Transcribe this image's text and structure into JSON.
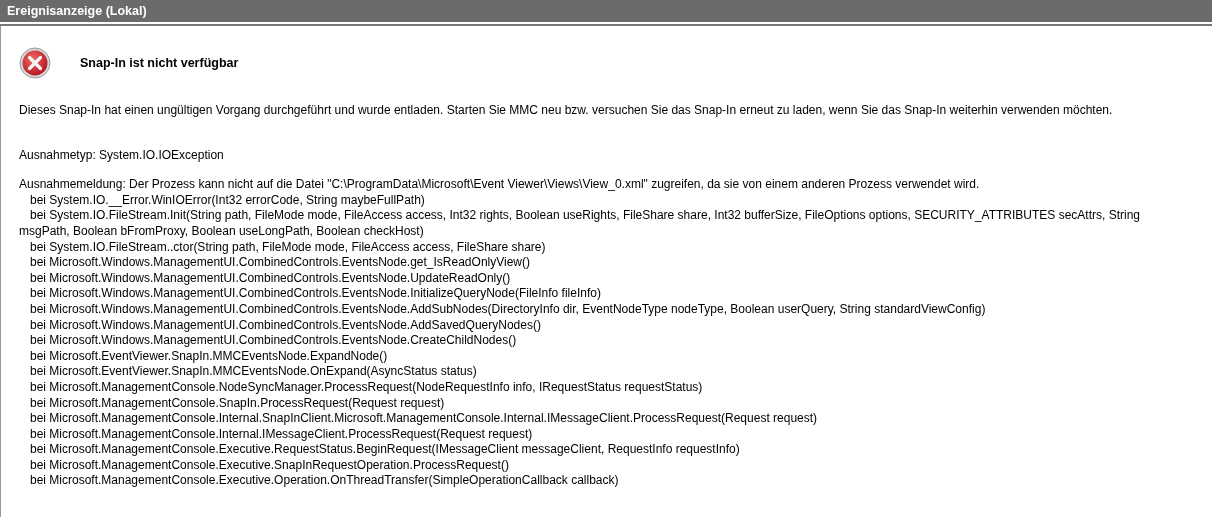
{
  "window": {
    "title": "Ereignisanzeige (Lokal)"
  },
  "error": {
    "heading": "Snap-In ist nicht verfügbar",
    "description": "Dieses Snap-In hat einen ungültigen Vorgang durchgeführt und wurde entladen. Starten Sie MMC neu bzw. versuchen Sie das Snap-In erneut zu laden, wenn Sie das Snap-In weiterhin verwenden möchten.",
    "exception_type": "Ausnahmetyp: System.IO.IOException",
    "exception_message": "Ausnahmemeldung: Der Prozess kann nicht auf die Datei \"C:\\ProgramData\\Microsoft\\Event Viewer\\Views\\View_0.xml\" zugreifen, da sie von einem anderen Prozess verwendet wird.",
    "stack_trace": [
      "bei System.IO.__Error.WinIOError(Int32 errorCode, String maybeFullPath)",
      "bei System.IO.FileStream.Init(String path, FileMode mode, FileAccess access, Int32 rights, Boolean useRights, FileShare share, Int32 bufferSize, FileOptions options, SECURITY_ATTRIBUTES secAttrs, String msgPath, Boolean bFromProxy, Boolean useLongPath, Boolean checkHost)",
      "bei System.IO.FileStream..ctor(String path, FileMode mode, FileAccess access, FileShare share)",
      "bei Microsoft.Windows.ManagementUI.CombinedControls.EventsNode.get_IsReadOnlyView()",
      "bei Microsoft.Windows.ManagementUI.CombinedControls.EventsNode.UpdateReadOnly()",
      "bei Microsoft.Windows.ManagementUI.CombinedControls.EventsNode.InitializeQueryNode(FileInfo fileInfo)",
      "bei Microsoft.Windows.ManagementUI.CombinedControls.EventsNode.AddSubNodes(DirectoryInfo dir, EventNodeType nodeType, Boolean userQuery, String standardViewConfig)",
      "bei Microsoft.Windows.ManagementUI.CombinedControls.EventsNode.AddSavedQueryNodes()",
      "bei Microsoft.Windows.ManagementUI.CombinedControls.EventsNode.CreateChildNodes()",
      "bei Microsoft.EventViewer.SnapIn.MMCEventsNode.ExpandNode()",
      "bei Microsoft.EventViewer.SnapIn.MMCEventsNode.OnExpand(AsyncStatus status)",
      "bei Microsoft.ManagementConsole.NodeSyncManager.ProcessRequest(NodeRequestInfo info, IRequestStatus requestStatus)",
      "bei Microsoft.ManagementConsole.SnapIn.ProcessRequest(Request request)",
      "bei Microsoft.ManagementConsole.Internal.SnapInClient.Microsoft.ManagementConsole.Internal.IMessageClient.ProcessRequest(Request request)",
      "bei Microsoft.ManagementConsole.Internal.IMessageClient.ProcessRequest(Request request)",
      "bei Microsoft.ManagementConsole.Executive.RequestStatus.BeginRequest(IMessageClient messageClient, RequestInfo requestInfo)",
      "bei Microsoft.ManagementConsole.Executive.SnapInRequestOperation.ProcessRequest()",
      "bei Microsoft.ManagementConsole.Executive.Operation.OnThreadTransfer(SimpleOperationCallback callback)"
    ]
  }
}
